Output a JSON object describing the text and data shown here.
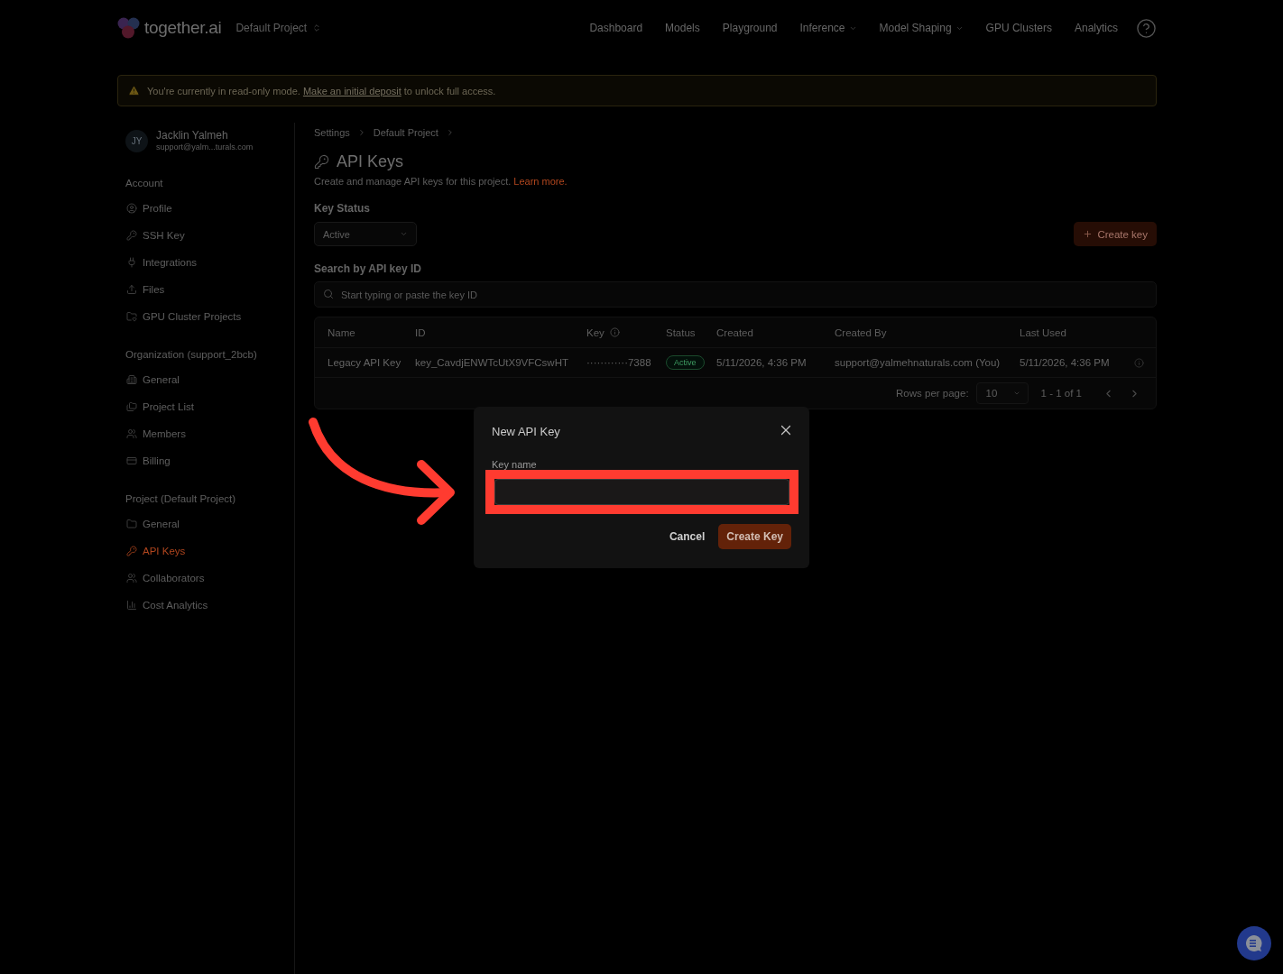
{
  "header": {
    "logo": "together.ai",
    "project": "Default Project",
    "nav": [
      {
        "label": "Dashboard",
        "has_menu": false
      },
      {
        "label": "Models",
        "has_menu": false
      },
      {
        "label": "Playground",
        "has_menu": false
      },
      {
        "label": "Inference",
        "has_menu": true
      },
      {
        "label": "Model Shaping",
        "has_menu": true
      },
      {
        "label": "GPU Clusters",
        "has_menu": false
      },
      {
        "label": "Analytics",
        "has_menu": false
      }
    ]
  },
  "banner": {
    "text": "You're currently in read-only mode.",
    "link": "Make an initial deposit",
    "text_after": "to unlock full access."
  },
  "sidebar": {
    "user": {
      "initials": "JY",
      "name": "Jacklin Yalmeh",
      "email": "support@yalm...turals.com"
    },
    "sections": [
      {
        "title": "Account",
        "items": [
          {
            "label": "Profile",
            "selected": false
          },
          {
            "label": "SSH Key",
            "selected": false
          },
          {
            "label": "Integrations",
            "selected": false
          },
          {
            "label": "Files",
            "selected": false
          },
          {
            "label": "GPU Cluster Projects",
            "selected": false
          }
        ]
      },
      {
        "title": "Organization (support_2bcb)",
        "items": [
          {
            "label": "General",
            "selected": false
          },
          {
            "label": "Project List",
            "selected": false
          },
          {
            "label": "Members",
            "selected": false
          },
          {
            "label": "Billing",
            "selected": false
          }
        ]
      },
      {
        "title": "Project (Default Project)",
        "items": [
          {
            "label": "General",
            "selected": false
          },
          {
            "label": "API Keys",
            "selected": true
          },
          {
            "label": "Collaborators",
            "selected": false
          },
          {
            "label": "Cost Analytics",
            "selected": false
          }
        ]
      }
    ]
  },
  "breadcrumb": [
    "Settings",
    "Default Project"
  ],
  "page": {
    "title": "API Keys",
    "description": "Create and manage API keys for this project.",
    "learn_more": "Learn more."
  },
  "filters": {
    "key_status": {
      "label": "Key Status",
      "value": "Active"
    },
    "create_button": "Create key",
    "search": {
      "label": "Search by API key ID",
      "placeholder": "Start typing or paste the key ID"
    }
  },
  "table": {
    "columns": [
      {
        "label": "Name",
        "info": false
      },
      {
        "label": "ID",
        "info": false
      },
      {
        "label": "Key",
        "info": true
      },
      {
        "label": "Status",
        "info": false
      },
      {
        "label": "Created",
        "info": false
      },
      {
        "label": "Created By",
        "info": false
      },
      {
        "label": "Last Used",
        "info": false
      }
    ],
    "rows": [
      {
        "name": "Legacy API Key",
        "id": "key_CavdjENWTcUtX9VFCswHT",
        "key": "············7388",
        "status": "Active",
        "created": "5/11/2026, 4:36 PM",
        "created_by": "support@yalmehnaturals.com (You)",
        "last_used": "5/11/2026, 4:36 PM"
      }
    ],
    "pagination": {
      "rows_per_page_label": "Rows per page:",
      "rows_per_page": "10",
      "range": "1 - 1 of 1"
    }
  },
  "modal": {
    "title": "New API Key",
    "field": {
      "label": "Key name"
    },
    "buttons": {
      "cancel": "Cancel",
      "submit": "Create Key"
    }
  }
}
